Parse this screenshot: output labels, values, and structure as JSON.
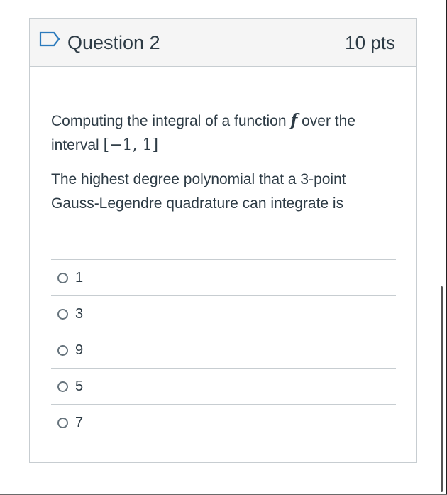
{
  "question": {
    "title": "Question 2",
    "points": "10 pts",
    "flag_icon": "flag-outline-icon",
    "prompt_part1": "Computing the integral of a function ",
    "prompt_func": "f",
    "prompt_part2": " over the interval ",
    "prompt_interval": "[−1, 1]",
    "prompt_line2": "The highest degree polynomial that a 3-point Gauss-Legendre quadrature can integrate is"
  },
  "answers": [
    {
      "label": "1"
    },
    {
      "label": "3"
    },
    {
      "label": "9"
    },
    {
      "label": "5"
    },
    {
      "label": "7"
    }
  ],
  "colors": {
    "text": "#2d3b45",
    "border": "#c7cdd1",
    "header_bg": "#f5f5f5",
    "flag": "#2b7abc"
  }
}
